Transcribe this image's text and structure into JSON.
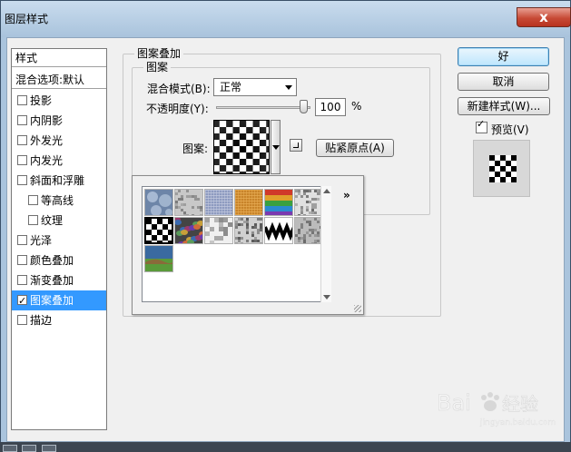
{
  "window": {
    "title": "图层样式",
    "close_glyph": "x"
  },
  "style_list": {
    "header": "样式",
    "blend_default": "混合选项:默认",
    "items": [
      {
        "label": "投影",
        "checked": false,
        "sub": false,
        "selected": false
      },
      {
        "label": "内阴影",
        "checked": false,
        "sub": false,
        "selected": false
      },
      {
        "label": "外发光",
        "checked": false,
        "sub": false,
        "selected": false
      },
      {
        "label": "内发光",
        "checked": false,
        "sub": false,
        "selected": false
      },
      {
        "label": "斜面和浮雕",
        "checked": false,
        "sub": false,
        "selected": false
      },
      {
        "label": "等高线",
        "checked": false,
        "sub": true,
        "selected": false
      },
      {
        "label": "纹理",
        "checked": false,
        "sub": true,
        "selected": false
      },
      {
        "label": "光泽",
        "checked": false,
        "sub": false,
        "selected": false
      },
      {
        "label": "颜色叠加",
        "checked": false,
        "sub": false,
        "selected": false
      },
      {
        "label": "渐变叠加",
        "checked": false,
        "sub": false,
        "selected": false
      },
      {
        "label": "图案叠加",
        "checked": true,
        "sub": false,
        "selected": true
      },
      {
        "label": "描边",
        "checked": false,
        "sub": false,
        "selected": false
      }
    ]
  },
  "pattern_overlay": {
    "group_title": "图案叠加",
    "sub_group_title": "图案",
    "blend_mode_label": "混合模式(B):",
    "blend_mode_value": "正常",
    "opacity_label": "不透明度(Y):",
    "opacity_value": "100",
    "opacity_fraction": 0.96,
    "opacity_unit": "%",
    "pattern_label": "图案:",
    "snap_origin_label": "贴紧原点(A)"
  },
  "picker": {
    "menu_glyph": "»",
    "tiles": [
      {
        "icon": "bubbles-pattern",
        "colors": [
          "#6d85a8",
          "#b5c6dd"
        ],
        "selected": false
      },
      {
        "icon": "gravel-pattern",
        "colors": [
          "#6e6e6e",
          "#c8c8c8"
        ],
        "selected": false
      },
      {
        "icon": "blue-fabric-pattern",
        "colors": [
          "#8e9bc0",
          "#c5ccdf"
        ],
        "selected": false
      },
      {
        "icon": "orange-burlap-pattern",
        "colors": [
          "#c8842a",
          "#e8ae56"
        ],
        "selected": false
      },
      {
        "icon": "rainbow-stripes-pattern",
        "colors": [
          "#d03a2a",
          "#2a8ad0"
        ],
        "selected": false
      },
      {
        "icon": "marble-pattern",
        "colors": [
          "#555555",
          "#e0e0e0"
        ],
        "selected": false
      },
      {
        "icon": "checkerboard-pattern",
        "colors": [
          "#000000",
          "#ffffff"
        ],
        "selected": true
      },
      {
        "icon": "colorful-stones-pattern",
        "colors": [
          "#9a3a6a",
          "#3a6ab0"
        ],
        "selected": false
      },
      {
        "icon": "clouds-pattern",
        "colors": [
          "#777777",
          "#f0f0f0"
        ],
        "selected": false
      },
      {
        "icon": "noise-pattern",
        "colors": [
          "#444444",
          "#d0d0d0"
        ],
        "selected": false
      },
      {
        "icon": "zigzag-pattern",
        "colors": [
          "#000000",
          "#ffffff"
        ],
        "selected": false
      },
      {
        "icon": "grainy-rock-pattern",
        "colors": [
          "#5a5a5a",
          "#bbbbbb"
        ],
        "selected": false
      },
      {
        "icon": "landscape-pattern",
        "colors": [
          "#3a6aa0",
          "#5a9a3a"
        ],
        "selected": false
      }
    ]
  },
  "buttons": {
    "ok": "好",
    "cancel": "取消",
    "new_style": "新建样式(W)...",
    "preview": "预览(V)",
    "preview_checked": true
  },
  "watermark": {
    "text": "Bai",
    "suffix": "经验",
    "domain": "jingyan.baidu.com"
  }
}
